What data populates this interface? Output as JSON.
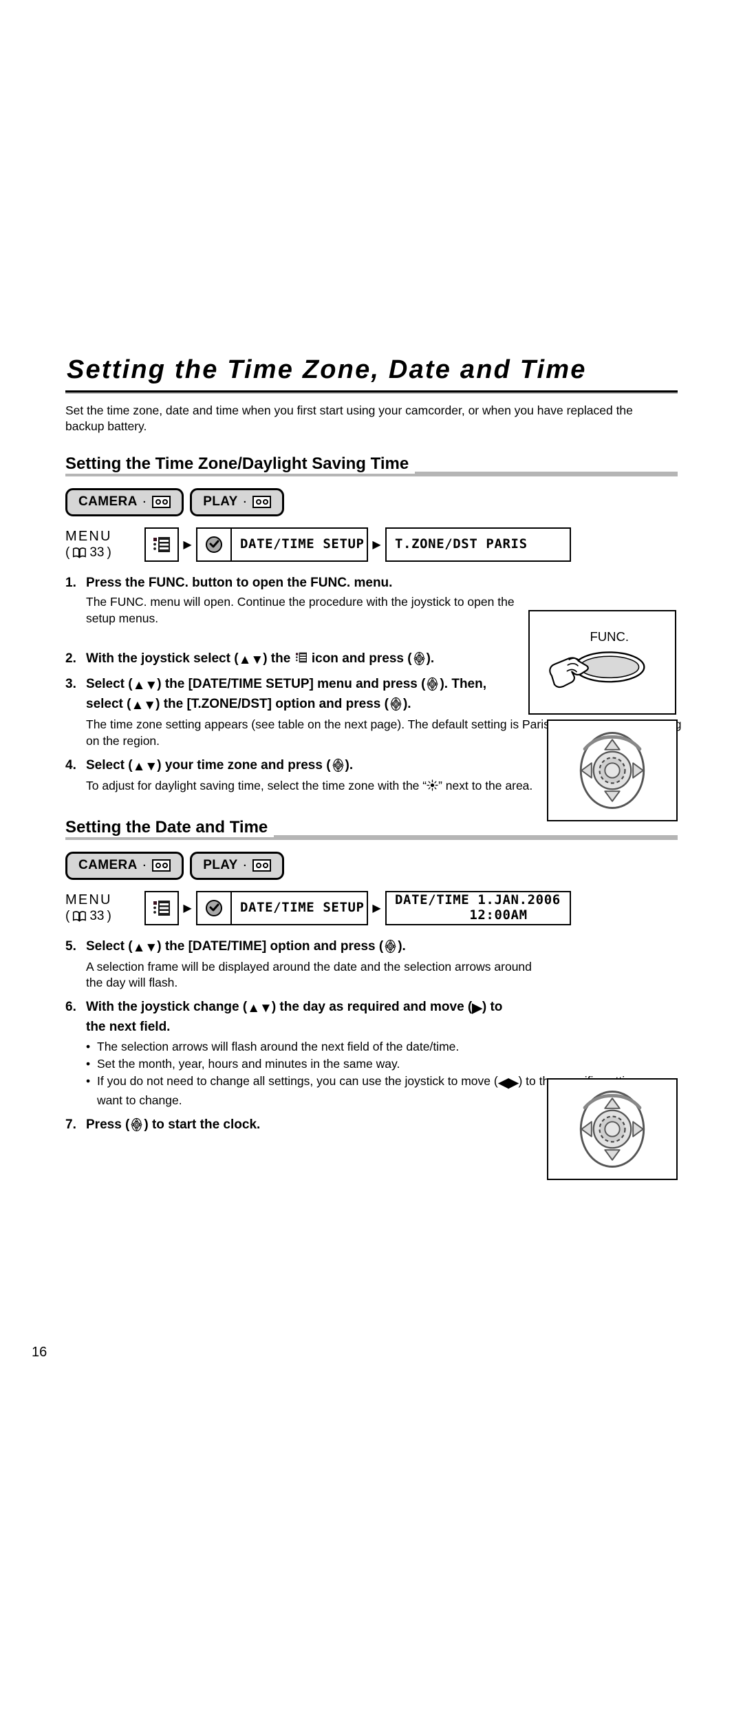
{
  "document": {
    "title": "Setting the Time Zone, Date and Time",
    "intro": "Set the time zone, date and time when you first start using your camcorder, or when you have replaced the backup battery.",
    "page_number": "16"
  },
  "sections": [
    {
      "heading": "Setting the Time Zone/Daylight Saving Time",
      "modes": [
        {
          "label": "CAMERA",
          "separator": "·",
          "media_icon": "cassette-tape-icon"
        },
        {
          "label": "PLAY",
          "separator": "·",
          "media_icon": "cassette-tape-icon"
        }
      ],
      "flow": {
        "label_line1": "MENU",
        "label_open_paren": "(",
        "label_page_ref": "33",
        "label_close_paren": ")",
        "book_icon": "open-book-icon",
        "items": [
          {
            "icon": "menu-list-icon",
            "text": ""
          },
          {
            "icon": "clock-icon",
            "text": "DATE/TIME SETUP"
          },
          {
            "icon": "",
            "text": "T.ZONE/DST PARIS"
          }
        ],
        "arrow_glyph": "▶"
      }
    },
    {
      "heading": "Setting the Date and Time",
      "modes": [
        {
          "label": "CAMERA",
          "separator": "·",
          "media_icon": "cassette-tape-icon"
        },
        {
          "label": "PLAY",
          "separator": "·",
          "media_icon": "cassette-tape-icon"
        }
      ],
      "flow": {
        "label_line1": "MENU",
        "label_open_paren": "(",
        "label_page_ref": "33",
        "label_close_paren": ")",
        "book_icon": "open-book-icon",
        "items": [
          {
            "icon": "menu-list-icon",
            "text": ""
          },
          {
            "icon": "clock-icon",
            "text": "DATE/TIME SETUP"
          },
          {
            "icon": "",
            "text": "DATE/TIME 1.JAN.2006\n         12:00AM"
          }
        ],
        "arrow_glyph": "▶"
      }
    }
  ],
  "steps": {
    "s1": {
      "num": "1.",
      "title": "Press the FUNC. button to open the FUNC. menu.",
      "note": "The FUNC. menu will open. Continue the procedure with the joystick to open the setup menus."
    },
    "s2": {
      "num": "2.",
      "t_a": "With the joystick select (",
      "t_b": ") the",
      "t_c": "icon and press (",
      "t_d": ")."
    },
    "s3": {
      "num": "3.",
      "t_a": "Select (",
      "t_b": ") the [DATE/TIME SETUP] menu and press (",
      "t_c": "). Then, select (",
      "t_d": ") the [T.ZONE/DST] option and press (",
      "t_e": ").",
      "note": "The time zone setting appears (see table on the next page). The default setting is Paris or Singapore depending on the region."
    },
    "s4": {
      "num": "4.",
      "t_a": "Select (",
      "t_b": ") your time zone and press (",
      "t_c": ").",
      "note_a": "To adjust for daylight saving time, select the time zone with the “",
      "note_b": "” next to the area."
    },
    "s5": {
      "num": "5.",
      "t_a": "Select (",
      "t_b": ") the [DATE/TIME] option and press (",
      "t_c": ").",
      "note": "A selection frame will be displayed around the date and the selection arrows around the day will flash."
    },
    "s6": {
      "num": "6.",
      "t_a": "With the joystick change (",
      "t_b": ") the day as required and move (",
      "t_c": ") to the next field.",
      "bullets": [
        {
          "a": "The selection arrows will flash around the next field of the date/time.",
          "b": ""
        },
        {
          "a": "Set the month, year, hours and minutes in the same way.",
          "b": ""
        },
        {
          "a": "If you do not need to change all settings, you can use the joystick to move (",
          "b": ") to the specific setting you want to change."
        }
      ]
    },
    "s7": {
      "num": "7.",
      "t_a": "Press (",
      "t_b": ") to start the clock."
    }
  },
  "illustrations": {
    "func_button": {
      "name": "func-button-illustration",
      "label": "FUNC."
    },
    "joystick_1": {
      "name": "joystick-illustration"
    },
    "joystick_2": {
      "name": "joystick-illustration"
    }
  },
  "glyphs": {
    "up_down": "▲▼",
    "right": "▶",
    "left_right": "◀▶",
    "bullet": "•"
  },
  "colors": {
    "text": "#000000",
    "rule_gray": "#b5b5b5",
    "badge_fill": "#d6d6d6",
    "background": "#ffffff"
  }
}
